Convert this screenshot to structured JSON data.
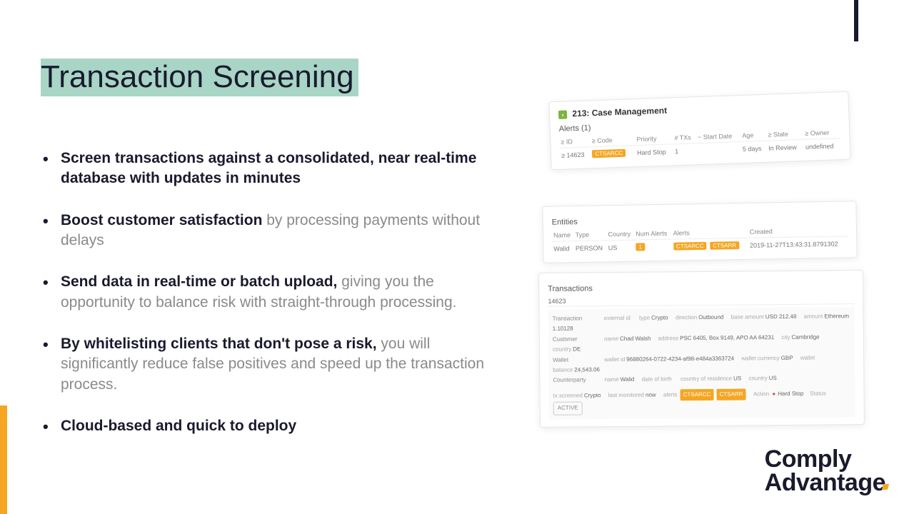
{
  "title": "Transaction Screening",
  "bullets": [
    {
      "bold": "Screen transactions against a consolidated, near real-time database with updates in minutes",
      "rest": ""
    },
    {
      "bold": "Boost customer satisfaction",
      "rest": " by processing payments without delays"
    },
    {
      "bold": "Send data in real-time or batch upload,",
      "rest": " giving you the opportunity to balance risk with straight-through processing."
    },
    {
      "bold": "By whitelisting clients that don't pose a risk,",
      "rest": " you will significantly reduce false positives and speed up the transaction process."
    },
    {
      "bold": "Cloud-based and quick to deploy",
      "rest": ""
    }
  ],
  "mock": {
    "case_title": "213: Case Management",
    "alerts_header": "Alerts (1)",
    "alerts_cols": [
      "≥ ID",
      "≥ Code",
      "Priority",
      "# TXs",
      "~ Start Date",
      "Age",
      "≥ State",
      "≥ Owner"
    ],
    "alerts_row": {
      "id": "≥ 14623",
      "code": "CTSARCC",
      "priority": "Hard Stop",
      "txs": "1",
      "start": "",
      "age": "5 days",
      "state": "In Review",
      "owner": "undefined"
    },
    "entities_header": "Entities",
    "entities_cols": [
      "Name",
      "Type",
      "Country",
      "Num Alerts",
      "Alerts",
      "Created"
    ],
    "entities_row": {
      "name": "Walid",
      "type": "PERSON",
      "country": "US",
      "num": "1",
      "alerts": [
        "CTSARCC",
        "CTSARR"
      ],
      "created": "2019-11-27T13:43:31.8791302"
    },
    "transactions_header": "Transactions",
    "tx_id": "14623",
    "tx": {
      "transaction": {
        "externalId": "",
        "type": "Crypto",
        "direction": "Outbound",
        "baseAmount": "USD 212.48",
        "amount": "Ethereum 1.10128"
      },
      "customer": {
        "name": "Chad Walsh",
        "address": "PSC 6405, Box 9149, APO AA 64231",
        "city": "Cambridge",
        "country": "DE"
      },
      "wallet": {
        "walletId": "96880264-0722-4234-af98-e484a3363724",
        "walletCurrency": "GBP",
        "walletBalance": "24,543.06"
      },
      "counterparty": {
        "name": "Walid",
        "dob": "",
        "countryOfResidence": "US",
        "country": "US"
      },
      "footer": {
        "txscreened": "Crypto",
        "lastMonitored": "now",
        "alerts": [
          "CTSARCC",
          "CTSARR"
        ],
        "actionLabel": "Action",
        "hardStop": "Hard Stop",
        "statusLabel": "Status",
        "statusValue": "ACTIVE"
      }
    }
  },
  "logo": {
    "line1": "Comply",
    "line2": "Advantage"
  }
}
